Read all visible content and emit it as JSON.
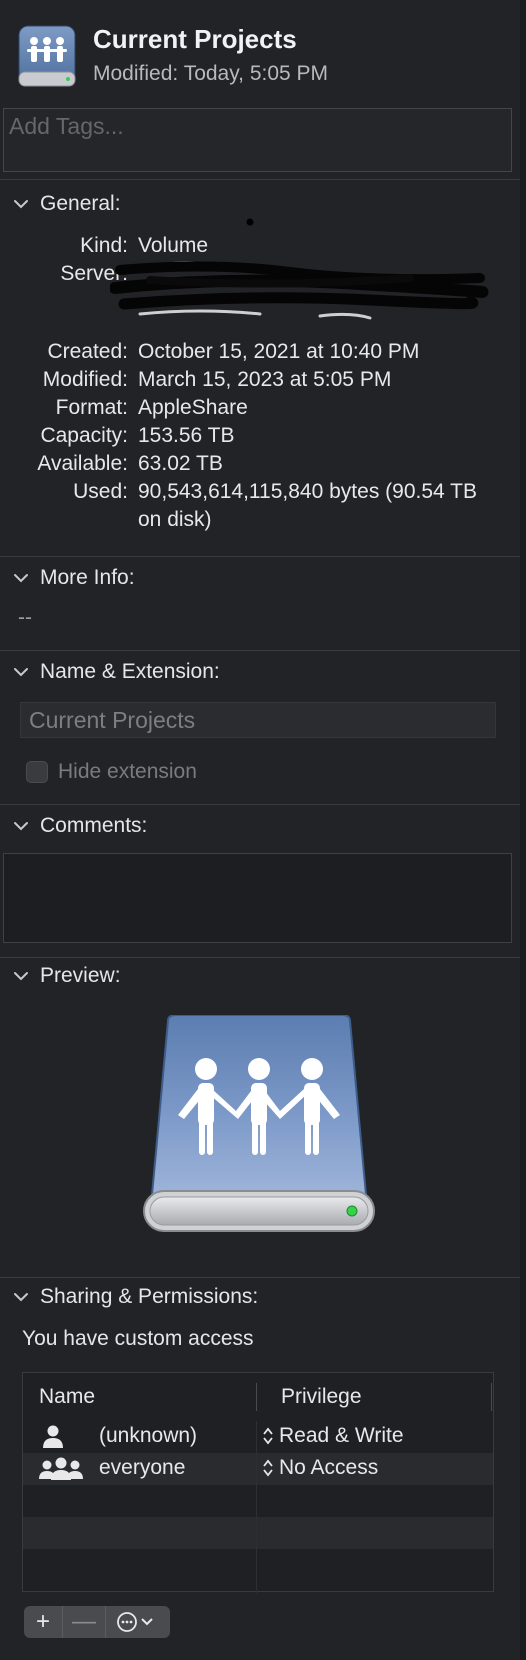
{
  "header": {
    "title": "Current Projects",
    "modified_label": "Modified:",
    "modified_value": "Today, 5:05 PM",
    "tags_placeholder": "Add Tags..."
  },
  "sections": {
    "general": "General:",
    "more_info": "More Info:",
    "name_extension": "Name & Extension:",
    "comments": "Comments:",
    "preview": "Preview:",
    "sharing": "Sharing & Permissions:"
  },
  "general": {
    "kind": {
      "label": "Kind:",
      "value": "Volume"
    },
    "server": {
      "label": "Server:",
      "value": ""
    },
    "created": {
      "label": "Created:",
      "value": "October 15, 2021 at 10:40 PM"
    },
    "modified": {
      "label": "Modified:",
      "value": "March 15, 2023 at 5:05 PM"
    },
    "format": {
      "label": "Format:",
      "value": "AppleShare"
    },
    "capacity": {
      "label": "Capacity:",
      "value": "153.56 TB"
    },
    "available": {
      "label": "Available:",
      "value": "63.02 TB"
    },
    "used": {
      "label": "Used:",
      "value": "90,543,614,115,840 bytes (90.54 TB on disk)"
    }
  },
  "more_info": {
    "value": "--"
  },
  "name_extension": {
    "name_value": "Current Projects",
    "hide_extension_label": "Hide extension",
    "hide_extension_checked": false
  },
  "comments": {
    "value": ""
  },
  "sharing": {
    "access_text": "You have custom access",
    "columns": {
      "name": "Name",
      "privilege": "Privilege"
    },
    "rows": [
      {
        "name": "(unknown)",
        "privilege": "Read & Write",
        "icon": "single-user-icon"
      },
      {
        "name": "everyone",
        "privilege": "No Access",
        "icon": "group-users-icon"
      }
    ],
    "buttons": {
      "add": "+",
      "remove": "—",
      "action": "⋯"
    }
  },
  "colors": {
    "background": "#222327",
    "drive_blue": "#5d82b4",
    "drive_light": "#8eaad4",
    "status_led": "#35d24a"
  }
}
